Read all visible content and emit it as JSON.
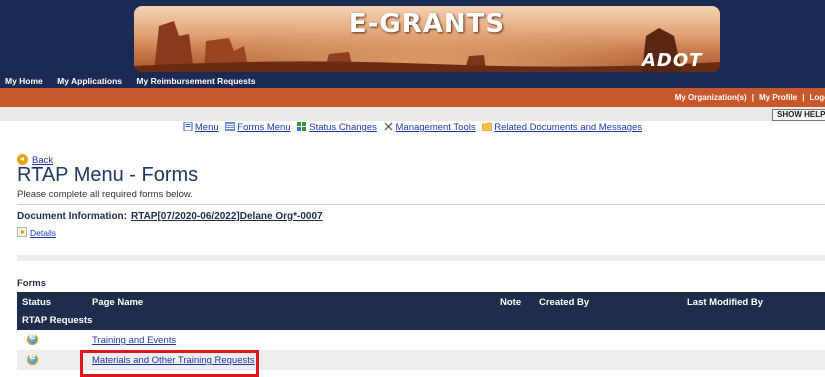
{
  "banner": {
    "title": "E-GRANTS",
    "logo_text": "ADOT"
  },
  "top_nav": {
    "items": [
      "My Home",
      "My Applications",
      "My Reimbursement Requests"
    ]
  },
  "user_links": {
    "items": [
      "My Organization(s)",
      "My Profile",
      "Logo"
    ]
  },
  "help_button": "SHOW HELP",
  "menu_bar": {
    "items": [
      {
        "label": "Menu",
        "icon": "document-icon"
      },
      {
        "label": "Forms Menu",
        "icon": "forms-icon"
      },
      {
        "label": "Status Changes",
        "icon": "status-icon"
      },
      {
        "label": "Management Tools",
        "icon": "tools-icon"
      },
      {
        "label": "Related Documents and Messages",
        "icon": "folder-icon"
      }
    ]
  },
  "back_label": "Back",
  "page_title": "RTAP Menu - Forms",
  "page_subtitle": "Please complete all required forms below.",
  "document_info": {
    "label": "Document Information:",
    "value": "RTAP[07/2020-06/2022]Delane Org*-0007"
  },
  "details_label": "Details",
  "forms_section_label": "Forms",
  "table": {
    "headers": {
      "status": "Status",
      "page_name": "Page Name",
      "note": "Note",
      "created_by": "Created By",
      "last_modified_by": "Last Modified By"
    },
    "group": "RTAP Requests",
    "rows": [
      {
        "status_icon": "ie-icon",
        "page_name": "Training and Events"
      },
      {
        "status_icon": "ie-icon",
        "page_name": "Materials and Other Training Requests"
      }
    ]
  },
  "colors": {
    "header_bg": "#1b2a55",
    "orange_bar": "#c8582c",
    "table_header": "#1f2d4d",
    "link": "#1a39a8",
    "highlight": "#e3131a"
  }
}
